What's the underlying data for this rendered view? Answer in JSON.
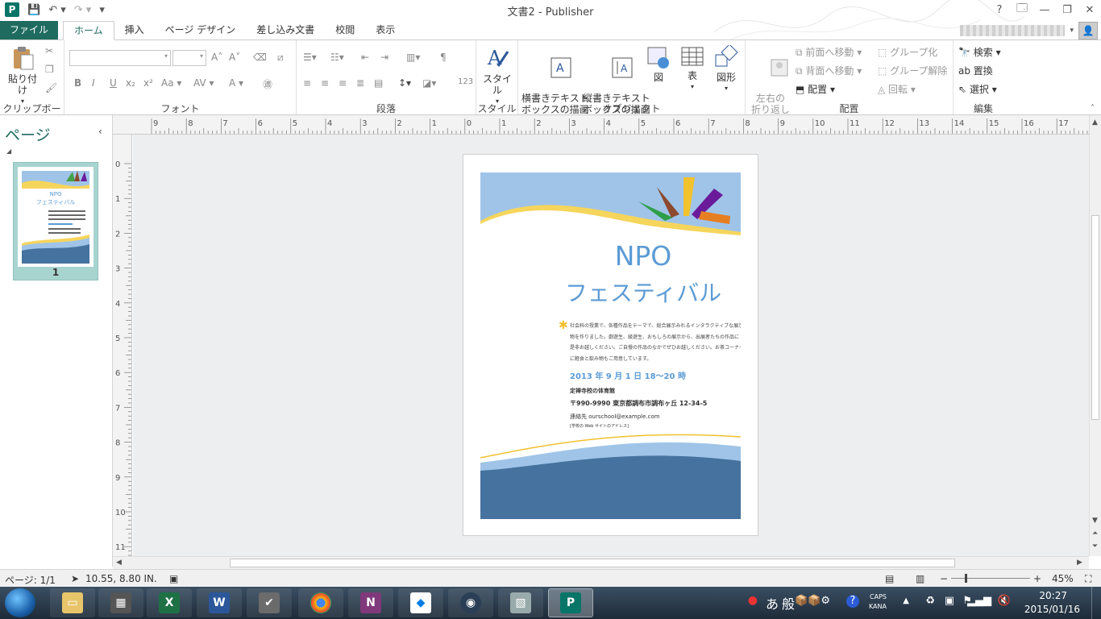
{
  "window": {
    "title": "文書2 - Publisher",
    "help": "?",
    "controls": [
      "🗔",
      "—",
      "❐",
      "✕"
    ]
  },
  "qat": {
    "app_letter": "P",
    "save": "💾",
    "undo": "↶ ▾",
    "redo": "↷ ▾",
    "customize": "▾"
  },
  "tabs": [
    "ファイル",
    "ホーム",
    "挿入",
    "ページ デザイン",
    "差し込み文書",
    "校閲",
    "表示"
  ],
  "active_tab": "ホーム",
  "ribbon": {
    "clipboard": {
      "paste": "貼り付け",
      "label": "クリップボード"
    },
    "font": {
      "label": "フォント",
      "buttons": [
        "B",
        "I",
        "U",
        "x₂",
        "x²",
        "Aa ▾",
        "AV ▾",
        "A ▾"
      ]
    },
    "paragraph": {
      "label": "段落",
      "number_button": "123"
    },
    "styles": {
      "style_button": "スタイル",
      "label": "スタイル"
    },
    "objects": {
      "label": "オブジェクト",
      "horizontal_textbox": "横書きテキスト\nボックスの描画",
      "vertical_textbox": "縦書きテキスト\nボックスの描画",
      "picture": "図",
      "table": "表",
      "shapes": "図形"
    },
    "arrange": {
      "label": "配置",
      "wrap": "左右の\n折り返し",
      "bring_forward": "前面へ移動",
      "send_backward": "背面へ移動",
      "align": "配置",
      "group": "グループ化",
      "ungroup": "グループ解除",
      "rotate": "回転"
    },
    "editing": {
      "label": "編集",
      "find": "検索",
      "replace": "置換",
      "select": "選択"
    }
  },
  "page_panel": {
    "title": "ページ",
    "collapse": "‹",
    "page_number": "1"
  },
  "rulers": {
    "horizontal": [
      "9",
      "8",
      "7",
      "6",
      "5",
      "4",
      "3",
      "2",
      "1",
      "0",
      "1",
      "2",
      "3",
      "4",
      "5",
      "6",
      "7",
      "8",
      "9",
      "10",
      "11",
      "12",
      "13",
      "14",
      "15",
      "16",
      "17"
    ],
    "vertical": [
      "0",
      "1",
      "2",
      "3",
      "4",
      "5",
      "6",
      "7",
      "8",
      "9",
      "10",
      "11"
    ]
  },
  "flyer": {
    "title_line1": "NPO",
    "title_line2": "フェスティバル",
    "body": [
      "社会科の授業で、各種作品をテーマで、総合展示みれるインタラクティブな展示",
      "物を作りました。劇遊生、級遊生、おもしろの展示から、出展者たちの作品に",
      "是非お越しください。ご自慢の作品のなかでぜひお越しください。お茶コーナー",
      "に軽食と飲み物もご用意しています。"
    ],
    "date": "2013 年 9 月 1 日 18～20 時",
    "venue": "定禅寺校の体育館",
    "address": "〒990-9990 東京都調布市調布ヶ丘 12-34-5",
    "contact": "連絡先 ourschool@example.com",
    "website": "[学校の Web サイトのアドレス]",
    "colors": {
      "sky": "#9fc4e8",
      "gold": "#f6d55c",
      "navy": "#45729f",
      "title": "#5b9bd5",
      "date": "#5b9bd5"
    }
  },
  "status": {
    "page": "ページ: 1/1",
    "position": "10.55, 8.80 IN.",
    "zoom": "45%"
  },
  "taskbar": {
    "tray_ime_a": "あ",
    "tray_ime_b": "般",
    "caps": "CAPS",
    "kana": "KANA",
    "time": "20:27",
    "date": "2015/01/16"
  }
}
